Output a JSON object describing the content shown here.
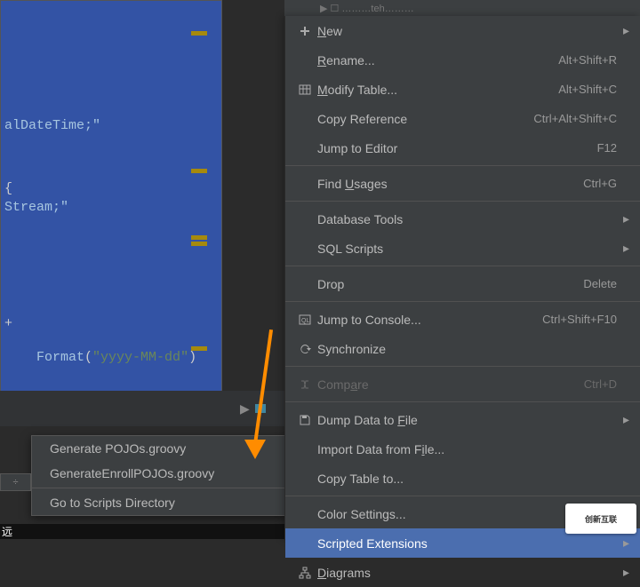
{
  "editor": {
    "line1": "alDateTime;\"",
    "brace": "{",
    "line2": "Stream;\"",
    "plus": "+",
    "format_prefix": "Format",
    "format_paren": "(",
    "format_str": "\"yyyy-MM-dd\"",
    "format_end": ")"
  },
  "toolbar": {
    "play": "▶"
  },
  "submenu": {
    "items": [
      {
        "label": "Generate POJOs.groovy"
      },
      {
        "label": "GenerateEnrollPOJOs.groovy"
      },
      {
        "label": "Go to Scripts Directory"
      }
    ]
  },
  "splitter": "÷",
  "bottom_text": "远",
  "top_fragment": "▶  ☐  ………teh………",
  "watermark": "创新互联",
  "menu": [
    {
      "icon": "plus",
      "label_pre": "",
      "mn": "N",
      "label_post": "ew",
      "shortcut": "",
      "arrow": true
    },
    {
      "icon": "",
      "label_pre": "",
      "mn": "R",
      "label_post": "ename...",
      "shortcut": "Alt+Shift+R",
      "arrow": false
    },
    {
      "icon": "table",
      "label_pre": "",
      "mn": "M",
      "label_post": "odify Table...",
      "shortcut": "Alt+Shift+C",
      "arrow": false
    },
    {
      "icon": "",
      "label_pre": "Copy Reference",
      "mn": "",
      "label_post": "",
      "shortcut": "Ctrl+Alt+Shift+C",
      "arrow": false
    },
    {
      "icon": "",
      "label_pre": "Jump to Editor",
      "mn": "",
      "label_post": "",
      "shortcut": "F12",
      "arrow": false
    },
    {
      "sep": true
    },
    {
      "icon": "",
      "label_pre": "Find ",
      "mn": "U",
      "label_post": "sages",
      "shortcut": "Ctrl+G",
      "arrow": false
    },
    {
      "sep": true
    },
    {
      "icon": "",
      "label_pre": "Database Tools",
      "mn": "",
      "label_post": "",
      "shortcut": "",
      "arrow": true
    },
    {
      "icon": "",
      "label_pre": "SQL Scripts",
      "mn": "",
      "label_post": "",
      "shortcut": "",
      "arrow": true
    },
    {
      "sep": true
    },
    {
      "icon": "",
      "label_pre": "Drop",
      "mn": "",
      "label_post": "",
      "shortcut": "Delete",
      "arrow": false
    },
    {
      "sep": true
    },
    {
      "icon": "console",
      "label_pre": "Jump to Console...",
      "mn": "",
      "label_post": "",
      "shortcut": "Ctrl+Shift+F10",
      "arrow": false
    },
    {
      "icon": "sync",
      "label_pre": "Synchronize",
      "mn": "",
      "label_post": "",
      "shortcut": "",
      "arrow": false
    },
    {
      "sep": true
    },
    {
      "icon": "compare",
      "label_pre": "Comp",
      "mn": "a",
      "label_post": "re",
      "shortcut": "Ctrl+D",
      "arrow": false,
      "disabled": true
    },
    {
      "sep": true
    },
    {
      "icon": "save",
      "label_pre": "Dump Data to ",
      "mn": "F",
      "label_post": "ile",
      "shortcut": "",
      "arrow": true
    },
    {
      "icon": "",
      "label_pre": "Import Data from F",
      "mn": "i",
      "label_post": "le...",
      "shortcut": "",
      "arrow": false
    },
    {
      "icon": "",
      "label_pre": "Copy Table to...",
      "mn": "",
      "label_post": "",
      "shortcut": "",
      "arrow": false
    },
    {
      "sep": true
    },
    {
      "icon": "",
      "label_pre": "Color Settings...",
      "mn": "",
      "label_post": "",
      "shortcut": "",
      "arrow": false
    },
    {
      "icon": "",
      "label_pre": "Scripted Extensions",
      "mn": "",
      "label_post": "",
      "shortcut": "",
      "arrow": true,
      "selected": true
    },
    {
      "icon": "diagram",
      "label_pre": "",
      "mn": "D",
      "label_post": "iagrams",
      "shortcut": "",
      "arrow": true
    }
  ]
}
